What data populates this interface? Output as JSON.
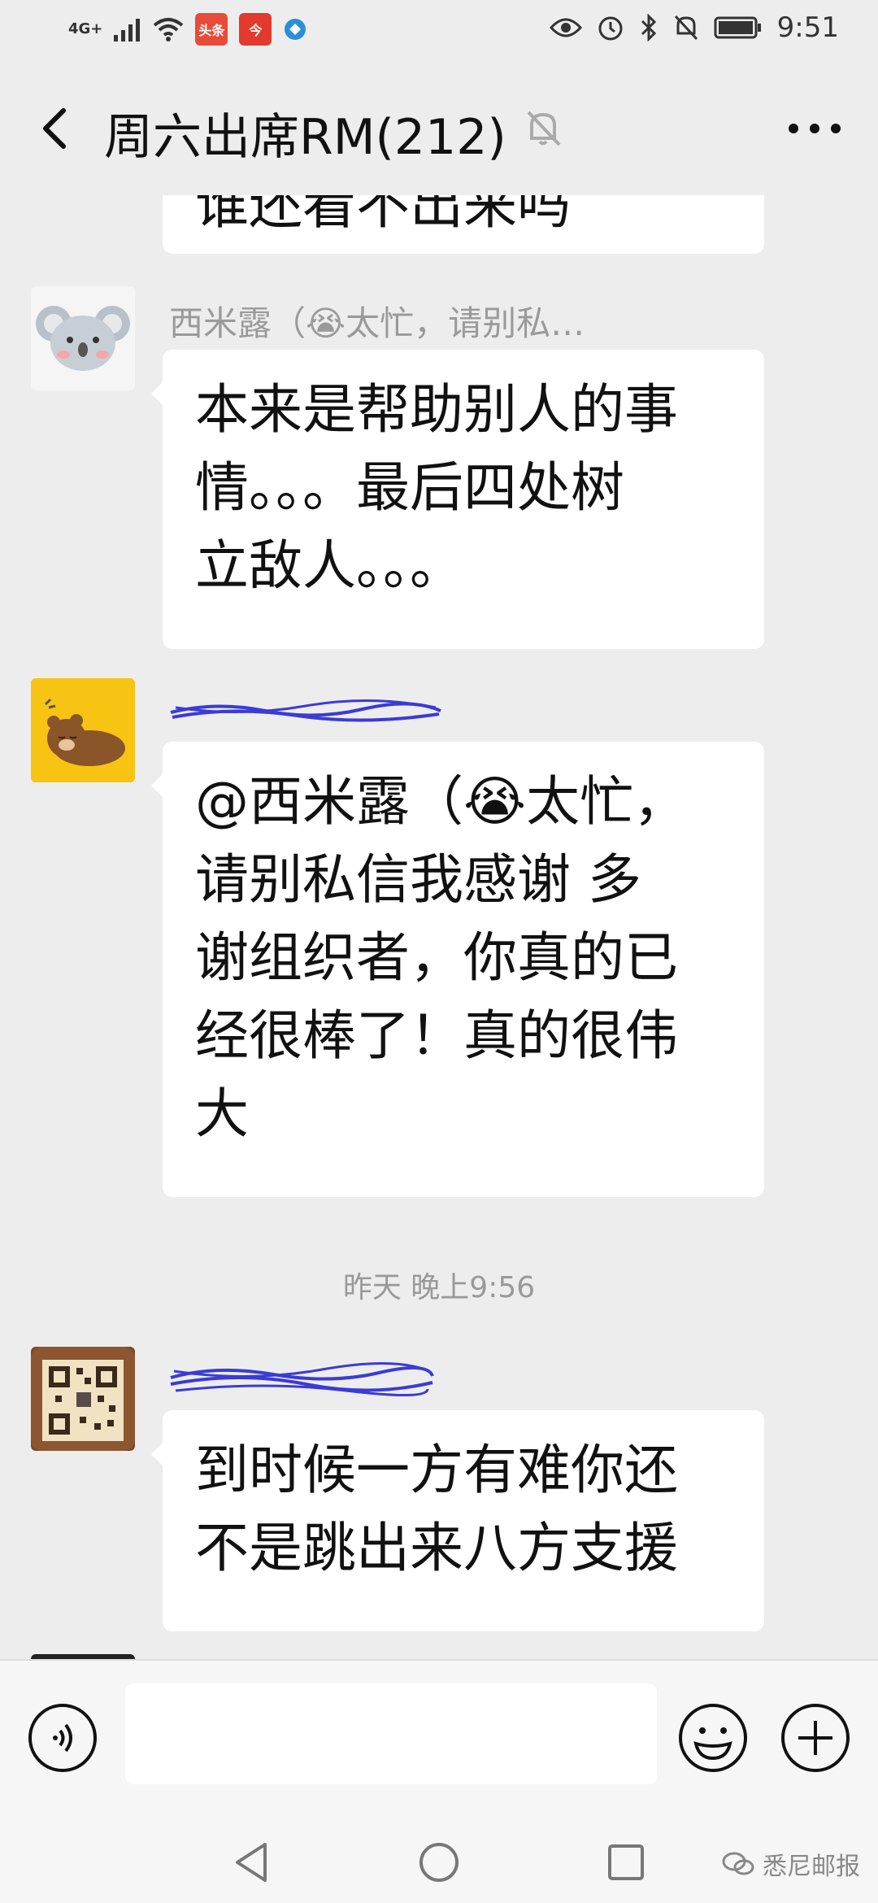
{
  "status_bar": {
    "network": "4G+",
    "app_badges": [
      "头条",
      "今"
    ],
    "time": "9:51",
    "icons": [
      "eye-icon",
      "alarm-icon",
      "bluetooth-icon",
      "mute-bell-icon",
      "battery-icon"
    ]
  },
  "header": {
    "title": "周六出席RM(212)",
    "muted": true
  },
  "messages": [
    {
      "type": "partial",
      "text": "谁还看不出来吗"
    },
    {
      "type": "message",
      "sender": "西米露（😭太忙，请别私…",
      "avatar": "koala",
      "lines": [
        "本来是帮助别人的事",
        "情。。。最后四处树",
        "立敌人。。。"
      ]
    },
    {
      "type": "message",
      "sender": "",
      "avatar": "bear",
      "lines": [
        "@西米露（😭太忙，",
        "请别私信我感谢  多",
        "谢组织者，你真的已",
        "经很棒了！真的很伟",
        "大"
      ]
    },
    {
      "type": "timestamp",
      "text": "昨天 晚上9:56"
    },
    {
      "type": "message",
      "sender": "",
      "avatar": "qr",
      "lines": [
        "到时候一方有难你还",
        "不是跳出来八方支援"
      ]
    }
  ],
  "input": {
    "placeholder": ""
  },
  "watermark": "悉尼邮报",
  "colors": {
    "background": "#ededed",
    "bubble": "#ffffff",
    "name": "#9a9a9a",
    "scribble": "#3b3bd6"
  }
}
